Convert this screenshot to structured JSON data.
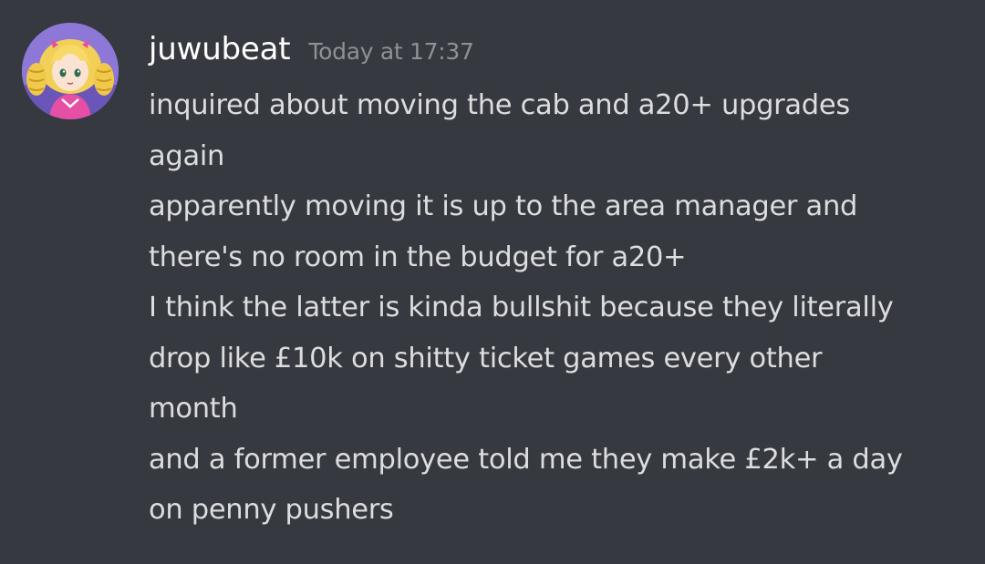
{
  "message": {
    "author": "juwubeat",
    "timestamp": "Today at 17:37",
    "avatar_icon": "anime-girl-avatar-icon",
    "lines": [
      "inquired about moving the cab and a20+ upgrades",
      "again",
      "apparently moving it is up to the area manager and",
      "there's no room in the budget for a20+",
      "I think the latter is kinda bullshit because they literally",
      "drop like £10k on shitty ticket games every other",
      "month",
      "and a former employee told me they make £2k+ a day",
      "on penny pushers"
    ]
  },
  "colors": {
    "background": "#36393f",
    "username": "#ffffff",
    "timestamp": "#8e9297",
    "text": "#dcddde"
  }
}
